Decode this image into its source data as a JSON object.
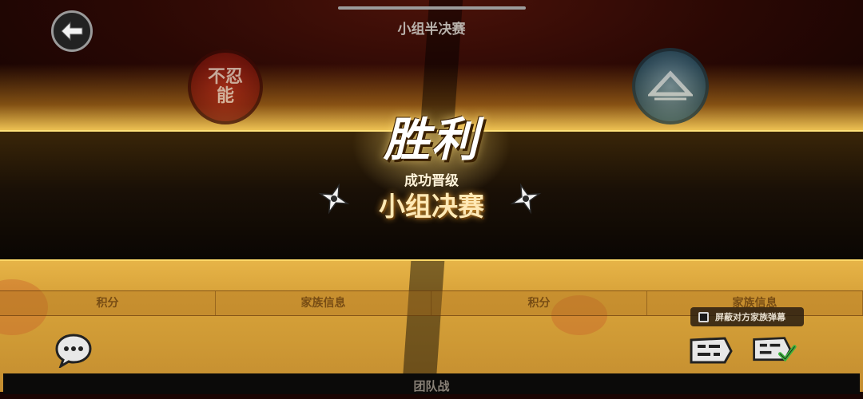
{
  "header": {
    "round_title": "小组半决赛"
  },
  "emblems": {
    "left_text": [
      "不忍",
      "能"
    ],
    "left_color": "#b22818",
    "right_color": "#2a5a6e"
  },
  "result": {
    "outcome": "胜利",
    "promotion_label": "成功晋级",
    "next_stage": "小组决赛"
  },
  "tabs": [
    {
      "label": "积分"
    },
    {
      "label": "家族信息"
    },
    {
      "label": "积分"
    },
    {
      "label": "家族信息"
    }
  ],
  "danmaku": {
    "block_opponent_label": "屏蔽对方家族弹幕",
    "checked": false
  },
  "footer": {
    "mode_label": "团队战"
  },
  "colors": {
    "accent_gold": "#ffd968",
    "banner_dark": "#1a1006"
  },
  "icons": [
    "back-arrow-icon",
    "chat-bubble-icon",
    "danmaku-icon",
    "danmaku-confirm-icon",
    "shuriken-icon"
  ]
}
